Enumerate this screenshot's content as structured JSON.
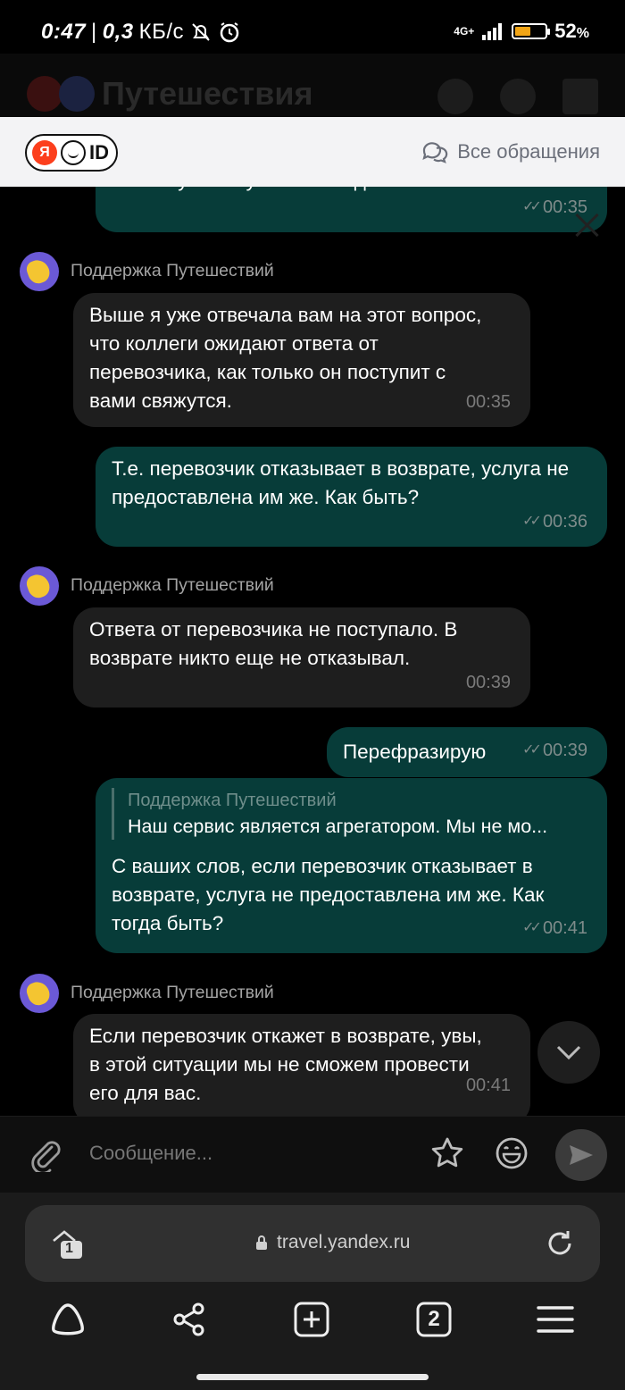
{
  "status_bar": {
    "time": "0:47",
    "separator": "|",
    "speed_value": "0,3",
    "speed_unit": "КБ/с",
    "network": "4G+",
    "battery_percent": "52",
    "battery_suffix": "%",
    "battery_level": 0.52,
    "battery_color": "#f2a516"
  },
  "travel_header": {
    "logo_text": "Путешествия"
  },
  "yandex_id_bar": {
    "logo_ya": "Я",
    "logo_id": "ID",
    "all_requests_label": "Все обращения"
  },
  "chat": {
    "messages": [
      {
        "dir": "out",
        "text": "выписку автобусов в этот день?",
        "time": "00:35"
      },
      {
        "dir": "in",
        "sender": "Поддержка Путешествий",
        "text": "Выше я уже отвечала вам на этот вопрос, что коллеги ожидают ответа от перевозчика, как только он поступит с вами свяжутся.",
        "time": "00:35"
      },
      {
        "dir": "out",
        "text": "Т.е. перевозчик отказывает в возврате, услуга не предоставлена им же. Как быть?",
        "time": "00:36"
      },
      {
        "dir": "in",
        "sender": "Поддержка Путешествий",
        "text": "Ответа от перевозчика не поступало. В возврате никто еще не отказывал.",
        "time": "00:39"
      },
      {
        "dir": "out",
        "text": "Перефразирую",
        "time": "00:39"
      },
      {
        "dir": "out",
        "quote_sender": "Поддержка Путешествий",
        "quote_text": "Наш сервис является агрегатором. Мы не мо...",
        "text": "С ваших слов, если перевозчик отказывает в возврате, услуга не предоставлена им же. Как тогда быть?",
        "time": "00:41"
      },
      {
        "dir": "in",
        "sender": "Поддержка Путешествий",
        "text": "Если перевозчик откажет в возврате, увы, в этой ситуации мы не сможем провести его для вас.",
        "time": "00:41"
      }
    ]
  },
  "composer": {
    "placeholder": "Сообщение..."
  },
  "browser": {
    "url": "travel.yandex.ru",
    "tabs_count": "2",
    "incognito_badge": "1"
  },
  "colors": {
    "outgoing_bubble": "#073c39",
    "incoming_bubble": "#1e1e1e",
    "yandex_red": "#fc3f1d"
  },
  "icons": [
    "clip-icon",
    "star-icon",
    "emoji-icon",
    "send-icon",
    "chevron-down-icon",
    "lock-icon",
    "reload-icon",
    "alice-icon",
    "share-icon",
    "new-tab-icon",
    "tabs-icon",
    "menu-icon",
    "chat-bubbles-icon",
    "bell-off-icon",
    "alarm-icon",
    "heart-icon"
  ]
}
